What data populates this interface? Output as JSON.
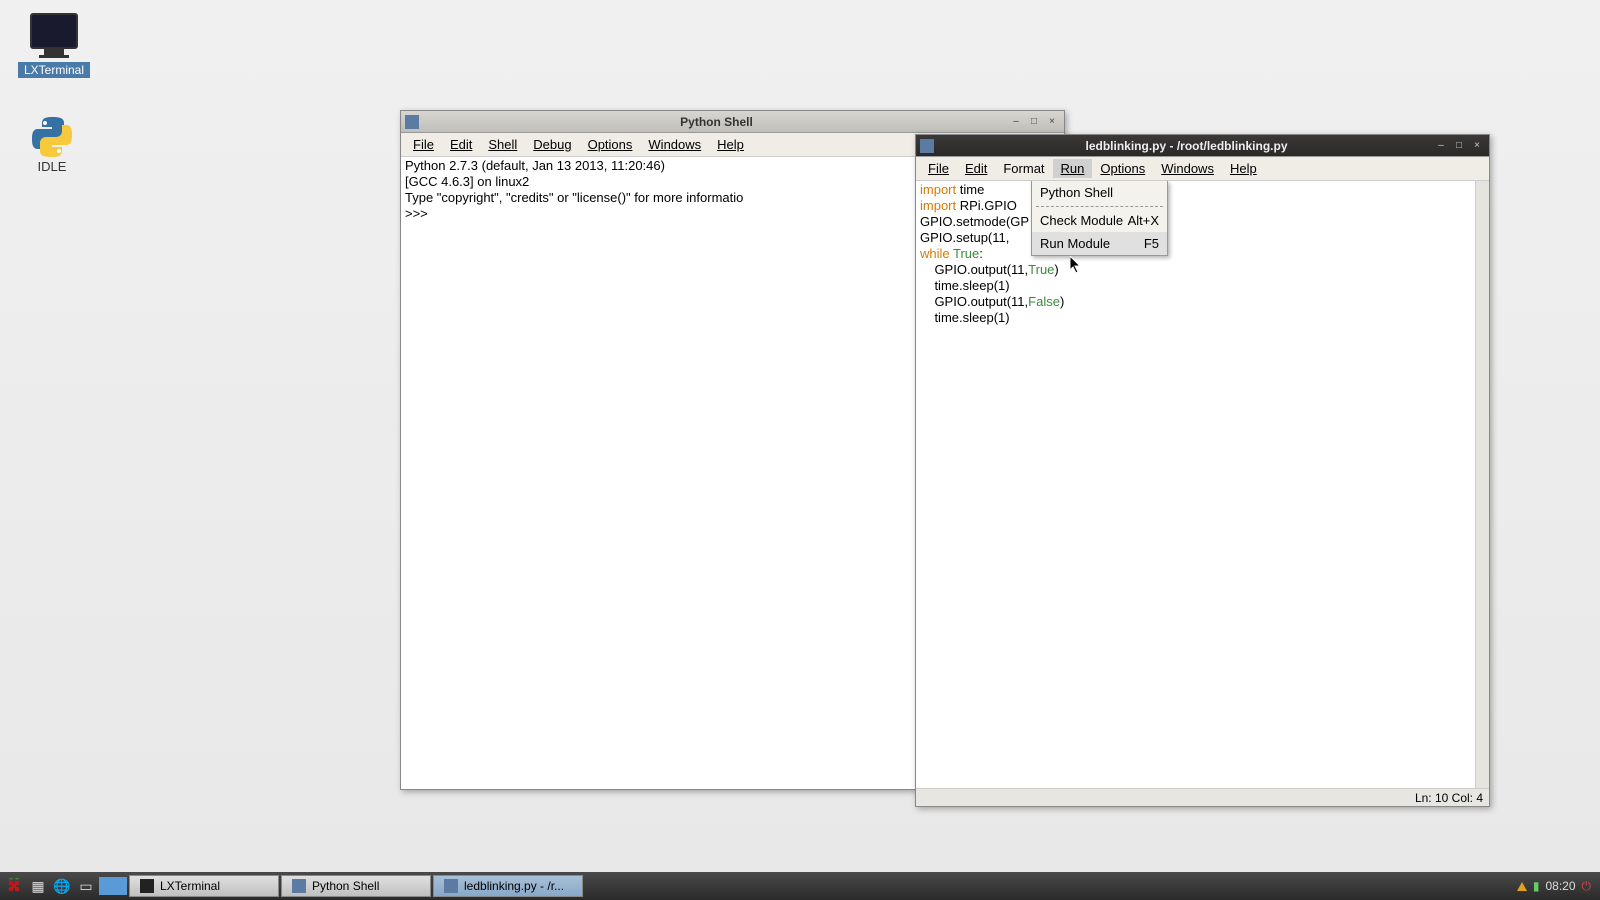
{
  "desktop_icons": {
    "lxterminal_label": "LXTerminal",
    "idle_label": "IDLE"
  },
  "shell_window": {
    "title": "Python Shell",
    "menus": {
      "file": "File",
      "edit": "Edit",
      "shell": "Shell",
      "debug": "Debug",
      "options": "Options",
      "windows": "Windows",
      "help": "Help"
    },
    "content_line1": "Python 2.7.3 (default, Jan 13 2013, 11:20:46)",
    "content_line2": "[GCC 4.6.3] on linux2",
    "content_line3": "Type \"copyright\", \"credits\" or \"license()\" for more informatio",
    "prompt": ">>> "
  },
  "editor_window": {
    "title": "ledblinking.py - /root/ledblinking.py",
    "menus": {
      "file": "File",
      "edit": "Edit",
      "format": "Format",
      "run": "Run",
      "options": "Options",
      "windows": "Windows",
      "help": "Help"
    },
    "code": {
      "l1_kw": "import",
      "l1_rest": " time",
      "l2_kw": "import",
      "l2_rest": " RPi.GPIO",
      "l3": "GPIO.setmode(GP",
      "l4": "GPIO.setup(11, ",
      "l5_kw": "while",
      "l5_mid": " ",
      "l5_val": "True",
      "l5_end": ":",
      "l6_pre": "    GPIO.output(11,",
      "l6_val": "True",
      "l6_end": ")",
      "l7": "    time.sleep(1)",
      "l8_pre": "    GPIO.output(11,",
      "l8_val": "False",
      "l8_end": ")",
      "l9": "    time.sleep(1)"
    },
    "dropdown": {
      "item1": "Python Shell",
      "item2": "Check Module",
      "item2_accel": "Alt+X",
      "item3": "Run Module",
      "item3_accel": "F5"
    },
    "status": "Ln: 10 Col: 4"
  },
  "taskbar": {
    "btn1": "LXTerminal",
    "btn2": "Python Shell",
    "btn3": "ledblinking.py - /r...",
    "clock": "08:20"
  }
}
